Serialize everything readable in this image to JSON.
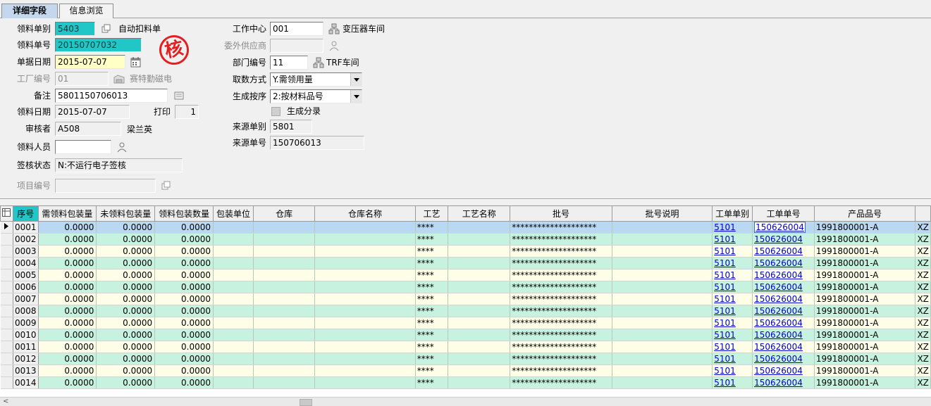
{
  "tabs": [
    {
      "label": "详细字段",
      "active": true
    },
    {
      "label": "信息浏览",
      "active": false
    }
  ],
  "form": {
    "requisition_type_label": "领料单别",
    "requisition_type": "5403",
    "requisition_type_name": "自动扣料单",
    "requisition_no_label": "领料单号",
    "requisition_no": "20150707032",
    "doc_date_label": "单据日期",
    "doc_date": "2015-07-07",
    "plant_no_label": "工厂编号",
    "plant_no": "01",
    "plant_name": "赛特勤磁电",
    "remark_label": "备注",
    "remark": "5801150706013",
    "pick_date_label": "领料日期",
    "pick_date": "2015-07-07",
    "print_label": "打印",
    "print_count": "1",
    "reviewer_label": "审核者",
    "reviewer_code": "A508",
    "reviewer_name": "梁兰英",
    "picker_label": "领料人员",
    "picker": "",
    "sign_status_label": "签核状态",
    "sign_status": "N:不运行电子签核",
    "project_no_label": "项目编号",
    "project_no": "",
    "work_center_label": "工作中心",
    "work_center": "001",
    "work_center_name": "变压器车间",
    "outsource_label": "委外供应商",
    "outsource": "",
    "dept_label": "部门编号",
    "dept_no": "11",
    "dept_name": "TRF车间",
    "fetch_method_label": "取数方式",
    "fetch_method": "Y.需领用量",
    "gen_order_label": "生成按序",
    "gen_order": "2:按材料品号",
    "gen_entry_label": "生成分录",
    "source_type_label": "来源单别",
    "source_type": "5801",
    "source_no_label": "来源单号",
    "source_no": "150706013",
    "stamp_char": "核"
  },
  "grid": {
    "columns": [
      "序号",
      "需领料包装量",
      "未领料包装量",
      "领料包装数量",
      "包装单位",
      "仓库",
      "仓库名称",
      "工艺",
      "工艺名称",
      "批号",
      "批号说明",
      "工单单别",
      "工单单号",
      "产品品号",
      ""
    ],
    "rows": [
      {
        "seq": "0001",
        "need": "0.0000",
        "unpicked": "0.0000",
        "picked": "0.0000",
        "process": "****",
        "lot": "********************",
        "wo_type": "5101",
        "wo_no": "150626004",
        "product": "1991800001-A",
        "extra": "XZ"
      },
      {
        "seq": "0002",
        "need": "0.0000",
        "unpicked": "0.0000",
        "picked": "0.0000",
        "process": "****",
        "lot": "********************",
        "wo_type": "5101",
        "wo_no": "150626004",
        "product": "1991800001-A",
        "extra": "XZ"
      },
      {
        "seq": "0003",
        "need": "0.0000",
        "unpicked": "0.0000",
        "picked": "0.0000",
        "process": "****",
        "lot": "********************",
        "wo_type": "5101",
        "wo_no": "150626004",
        "product": "1991800001-A",
        "extra": "XZ"
      },
      {
        "seq": "0004",
        "need": "0.0000",
        "unpicked": "0.0000",
        "picked": "0.0000",
        "process": "****",
        "lot": "********************",
        "wo_type": "5101",
        "wo_no": "150626004",
        "product": "1991800001-A",
        "extra": "XZ"
      },
      {
        "seq": "0005",
        "need": "0.0000",
        "unpicked": "0.0000",
        "picked": "0.0000",
        "process": "****",
        "lot": "********************",
        "wo_type": "5101",
        "wo_no": "150626004",
        "product": "1991800001-A",
        "extra": "XZ"
      },
      {
        "seq": "0006",
        "need": "0.0000",
        "unpicked": "0.0000",
        "picked": "0.0000",
        "process": "****",
        "lot": "********************",
        "wo_type": "5101",
        "wo_no": "150626004",
        "product": "1991800001-A",
        "extra": "XZ"
      },
      {
        "seq": "0007",
        "need": "0.0000",
        "unpicked": "0.0000",
        "picked": "0.0000",
        "process": "****",
        "lot": "********************",
        "wo_type": "5101",
        "wo_no": "150626004",
        "product": "1991800001-A",
        "extra": "XZ"
      },
      {
        "seq": "0008",
        "need": "0.0000",
        "unpicked": "0.0000",
        "picked": "0.0000",
        "process": "****",
        "lot": "********************",
        "wo_type": "5101",
        "wo_no": "150626004",
        "product": "1991800001-A",
        "extra": "XZ"
      },
      {
        "seq": "0009",
        "need": "0.0000",
        "unpicked": "0.0000",
        "picked": "0.0000",
        "process": "****",
        "lot": "********************",
        "wo_type": "5101",
        "wo_no": "150626004",
        "product": "1991800001-A",
        "extra": "XZ"
      },
      {
        "seq": "0010",
        "need": "0.0000",
        "unpicked": "0.0000",
        "picked": "0.0000",
        "process": "****",
        "lot": "********************",
        "wo_type": "5101",
        "wo_no": "150626004",
        "product": "1991800001-A",
        "extra": "XZ"
      },
      {
        "seq": "0011",
        "need": "0.0000",
        "unpicked": "0.0000",
        "picked": "0.0000",
        "process": "****",
        "lot": "********************",
        "wo_type": "5101",
        "wo_no": "150626004",
        "product": "1991800001-A",
        "extra": "XZ"
      },
      {
        "seq": "0012",
        "need": "0.0000",
        "unpicked": "0.0000",
        "picked": "0.0000",
        "process": "****",
        "lot": "********************",
        "wo_type": "5101",
        "wo_no": "150626004",
        "product": "1991800001-A",
        "extra": "XZ"
      },
      {
        "seq": "0013",
        "need": "0.0000",
        "unpicked": "0.0000",
        "picked": "0.0000",
        "process": "****",
        "lot": "********************",
        "wo_type": "5101",
        "wo_no": "150626004",
        "product": "1991800001-A",
        "extra": "XZ"
      },
      {
        "seq": "0014",
        "need": "0.0000",
        "unpicked": "0.0000",
        "picked": "0.0000",
        "process": "****",
        "lot": "********************",
        "wo_type": "5101",
        "wo_no": "150626004",
        "product": "1991800001-A",
        "extra": "XZ"
      }
    ]
  },
  "icons": {
    "copy": "copy-icon",
    "calendar": "calendar-icon",
    "factory": "factory-icon",
    "user": "user-icon",
    "network": "network-icon",
    "combo": "chevron-down-icon"
  },
  "colors": {
    "highlight_cyan": "#21c6c7",
    "date_yellow": "#ffffc6",
    "row_yellow": "#fdfde8",
    "row_green": "#c7f2df",
    "row_selected": "#b9d8f3",
    "tab_active": "#c5d7ec",
    "link": "#0000cc",
    "stamp_red": "#e31f1f"
  }
}
